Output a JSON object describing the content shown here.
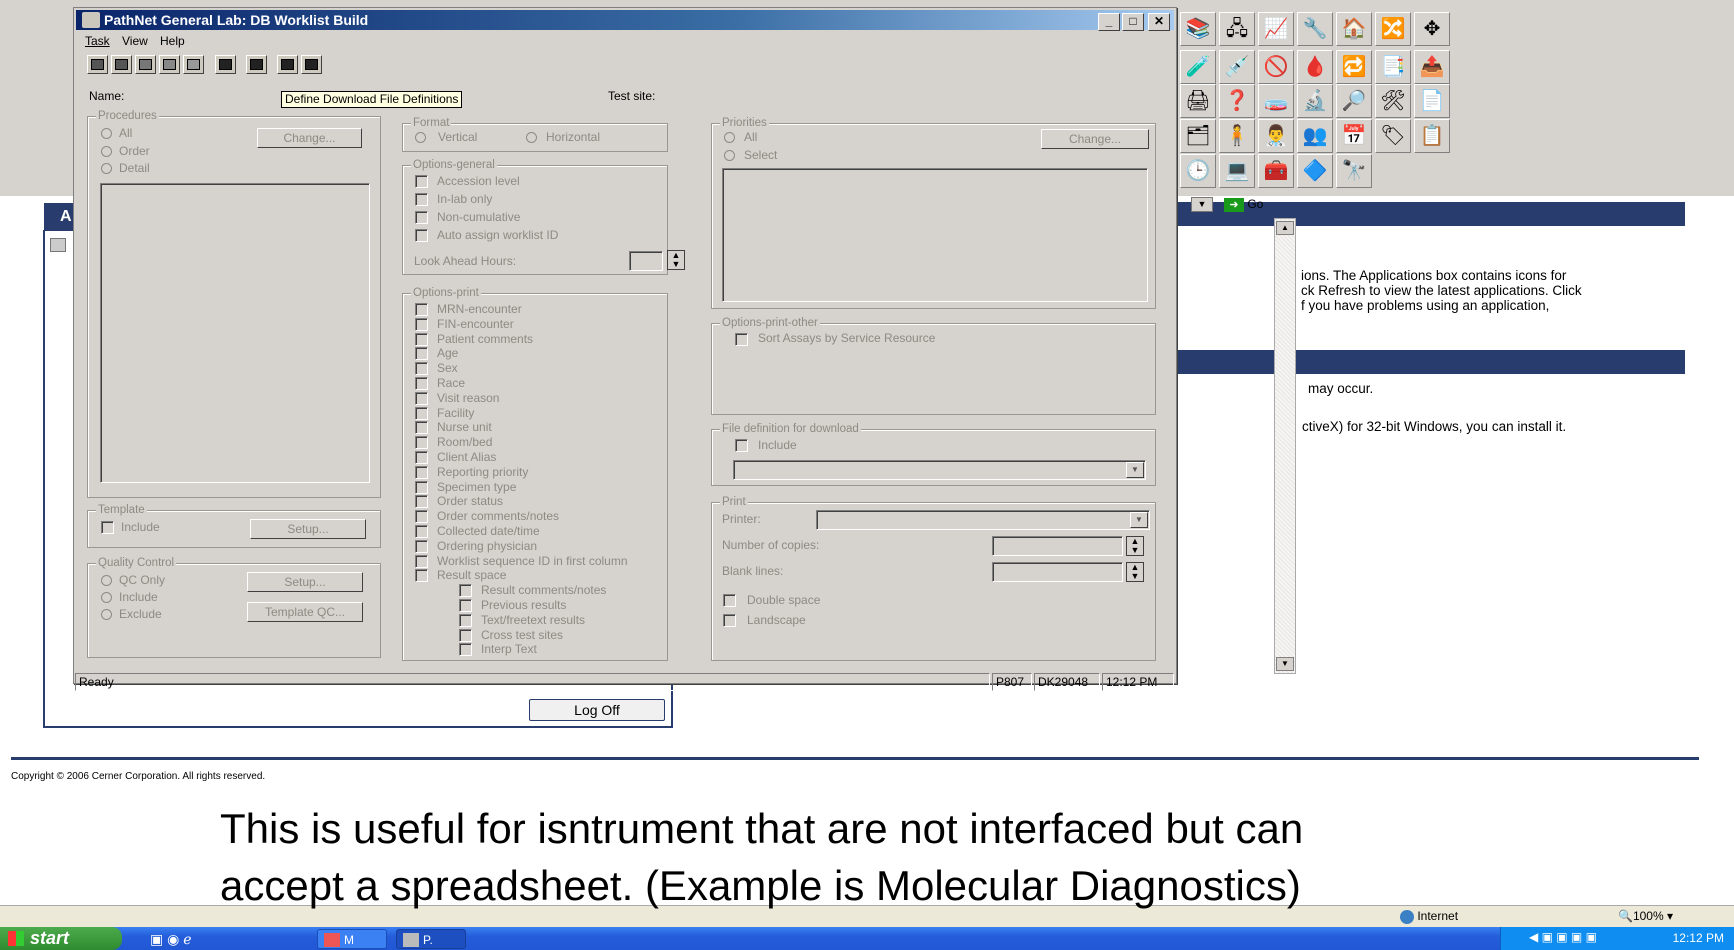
{
  "window": {
    "title": "PathNet General Lab: DB Worklist Build",
    "menu": [
      "Task",
      "View",
      "Help"
    ],
    "name_label": "Name:",
    "tooltip": "Define Download File Definitions",
    "test_site_label": "Test site:",
    "status": {
      "ready": "Ready",
      "cell1": "P807",
      "cell2": "DK29048",
      "cell3": "12:12 PM"
    }
  },
  "procedures": {
    "legend": "Procedures",
    "radios": [
      "All",
      "Order",
      "Detail"
    ],
    "change_button": "Change..."
  },
  "template": {
    "legend": "Template",
    "include": "Include",
    "setup_button": "Setup..."
  },
  "quality_control": {
    "legend": "Quality Control",
    "radios": [
      "QC Only",
      "Include",
      "Exclude"
    ],
    "setup_button": "Setup...",
    "template_qc_button": "Template QC..."
  },
  "format": {
    "legend": "Format",
    "vertical": "Vertical",
    "horizontal": "Horizontal"
  },
  "options_general": {
    "legend": "Options-general",
    "items": [
      "Accession level",
      "In-lab only",
      "Non-cumulative",
      "Auto assign worklist ID"
    ],
    "look_ahead_label": "Look Ahead Hours:"
  },
  "options_print": {
    "legend": "Options-print",
    "items": [
      "MRN-encounter",
      "FIN-encounter",
      "Patient comments",
      "Age",
      "Sex",
      "Race",
      "Visit reason",
      "Facility",
      "Nurse unit",
      "Room/bed",
      "Client Alias",
      "Reporting priority",
      "Specimen type",
      "Order status",
      "Order comments/notes",
      "Collected date/time",
      "Ordering physician",
      "Worklist sequence ID in first column",
      "Result space"
    ],
    "sub_items": [
      "Result comments/notes",
      "Previous results",
      "Text/freetext results",
      "Cross test sites",
      "Interp Text"
    ]
  },
  "priorities": {
    "legend": "Priorities",
    "radios": [
      "All",
      "Select"
    ],
    "change_button": "Change..."
  },
  "options_print_other": {
    "legend": "Options-print-other",
    "item": "Sort Assays by Service Resource"
  },
  "file_definition": {
    "legend": "File definition for download",
    "include": "Include"
  },
  "print": {
    "legend": "Print",
    "printer_label": "Printer:",
    "copies_label": "Number of copies:",
    "blank_label": "Blank lines:",
    "double_space": "Double space",
    "landscape": "Landscape"
  },
  "background": {
    "go_label": "Go",
    "text_line1": "ions. The Applications box contains icons for",
    "text_line2": "ck Refresh to view the latest applications. Click",
    "text_line3": "f you have problems using an application,",
    "text_line4": "may occur.",
    "text_line5": "ctiveX) for 32-bit Windows, you can install it.",
    "left_tab": "A",
    "log_off": "Log Off",
    "copyright": "Copyright © 2006 Cerner Corporation. All rights reserved.",
    "internet_zone": "Internet",
    "zoom": "100%"
  },
  "caption": {
    "line1": "This is useful for isntrument that are not interfaced but can",
    "line2": "accept a spreadsheet. (Example is Molecular Diagnostics)"
  },
  "taskbar": {
    "start": "start",
    "task1": "M",
    "task2": "P.",
    "clock": "12:12 PM"
  }
}
